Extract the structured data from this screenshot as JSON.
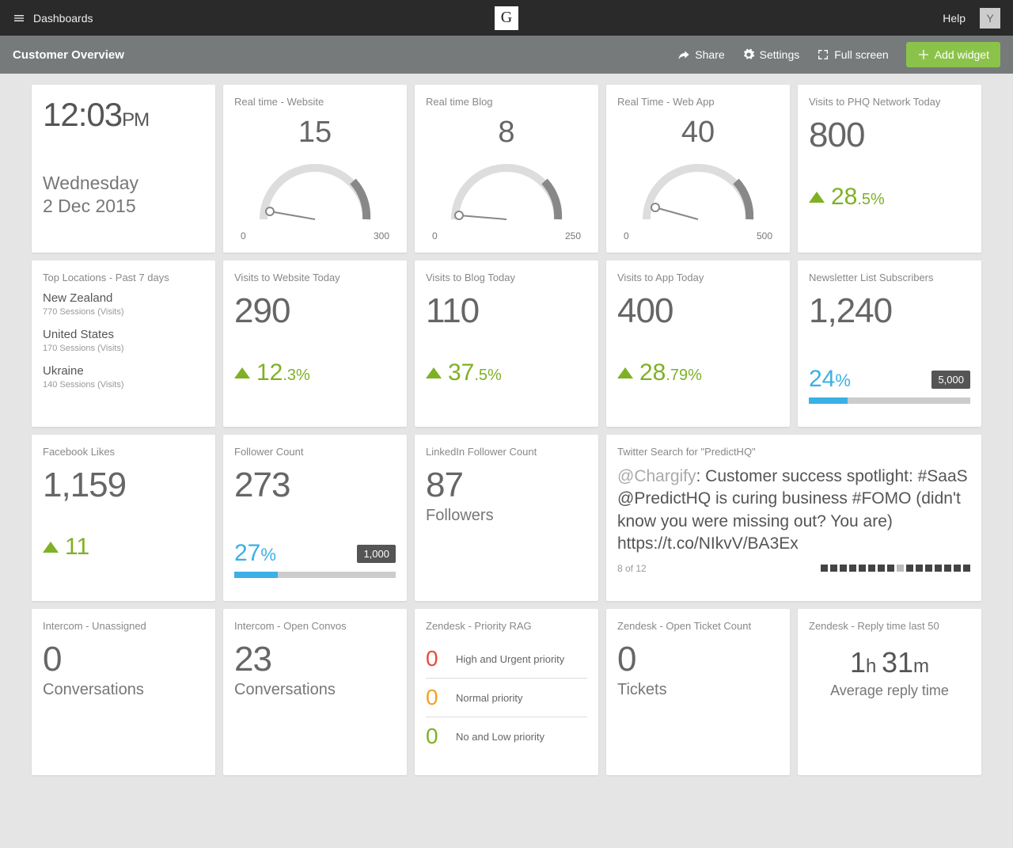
{
  "topbar": {
    "dashboards_label": "Dashboards",
    "logo_letter": "G",
    "help_label": "Help",
    "avatar_letter": "Y"
  },
  "subbar": {
    "title": "Customer Overview",
    "share": "Share",
    "settings": "Settings",
    "fullscreen": "Full screen",
    "add_widget": "Add widget"
  },
  "clock": {
    "time": "12:03",
    "ampm": "PM",
    "day": "Wednesday",
    "date": "2 Dec 2015"
  },
  "gauges": {
    "website": {
      "title": "Real time - Website",
      "value": "15",
      "min": "0",
      "max": "300",
      "ratio": 0.05
    },
    "blog": {
      "title": "Real time Blog",
      "value": "8",
      "min": "0",
      "max": "250",
      "ratio": 0.032
    },
    "webapp": {
      "title": "Real Time - Web App",
      "value": "40",
      "min": "0",
      "max": "500",
      "ratio": 0.08
    }
  },
  "phq": {
    "title": "Visits to PHQ Network Today",
    "value": "800",
    "delta_int": "28",
    "delta_dec": ".5%"
  },
  "locations": {
    "title": "Top Locations - Past 7 days",
    "items": [
      {
        "name": "New Zealand",
        "sessions": "770 Sessions (Visits)"
      },
      {
        "name": "United States",
        "sessions": "170 Sessions (Visits)"
      },
      {
        "name": "Ukraine",
        "sessions": "140 Sessions (Visits)"
      }
    ]
  },
  "visits_website": {
    "title": "Visits to Website Today",
    "value": "290",
    "delta_int": "12",
    "delta_dec": ".3%"
  },
  "visits_blog": {
    "title": "Visits to Blog Today",
    "value": "110",
    "delta_int": "37",
    "delta_dec": ".5%"
  },
  "visits_app": {
    "title": "Visits to App Today",
    "value": "400",
    "delta_int": "28",
    "delta_dec": ".79%"
  },
  "newsletter": {
    "title": "Newsletter List Subscribers",
    "value": "1,240",
    "pct": "24",
    "pct_sym": "%",
    "goal": "5,000",
    "progress": 24
  },
  "fb": {
    "title": "Facebook Likes",
    "value": "1,159",
    "delta": "11"
  },
  "followers": {
    "title": "Follower Count",
    "value": "273",
    "pct": "27",
    "pct_sym": "%",
    "goal": "1,000",
    "progress": 27
  },
  "linkedin": {
    "title": "LinkedIn Follower Count",
    "value": "87",
    "sub": "Followers"
  },
  "twitter": {
    "title": "Twitter Search for \"PredictHQ\"",
    "handle": "@Chargify",
    "text": ": Customer success spotlight: #SaaS @PredictHQ is curing business #FOMO (didn't know you were missing out? You are) https://t.co/NIkvV/BA3Ex",
    "index": "8 of 12",
    "total_dots": 16,
    "active_dot": 8
  },
  "intercom_unassigned": {
    "title": "Intercom - Unassigned",
    "value": "0",
    "sub": "Conversations"
  },
  "intercom_open": {
    "title": "Intercom - Open Convos",
    "value": "23",
    "sub": "Conversations"
  },
  "zendesk_rag": {
    "title": "Zendesk - Priority RAG",
    "items": [
      {
        "num": "0",
        "label": "High and Urgent priority",
        "class": "rag-red"
      },
      {
        "num": "0",
        "label": "Normal priority",
        "class": "rag-orange"
      },
      {
        "num": "0",
        "label": "No and Low priority",
        "class": "rag-green"
      }
    ]
  },
  "zendesk_open": {
    "title": "Zendesk - Open Ticket Count",
    "value": "0",
    "sub": "Tickets"
  },
  "zendesk_reply": {
    "title": "Zendesk - Reply time last 50",
    "h": "1",
    "h_unit": "h ",
    "m": "31",
    "m_unit": "m",
    "sub": "Average reply time"
  }
}
